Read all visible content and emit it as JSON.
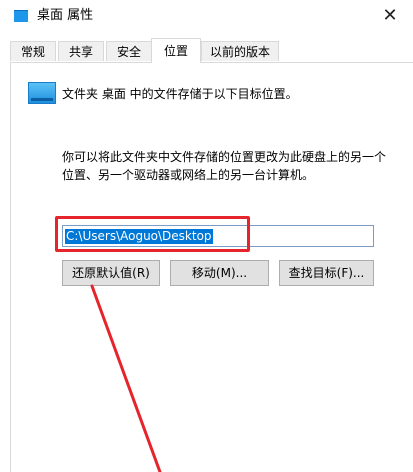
{
  "window": {
    "title": "桌面 属性",
    "close_glyph": "✕"
  },
  "tabs": [
    {
      "label": "常规",
      "active": false
    },
    {
      "label": "共享",
      "active": false
    },
    {
      "label": "安全",
      "active": false
    },
    {
      "label": "位置",
      "active": true
    },
    {
      "label": "以前的版本",
      "active": false
    }
  ],
  "location": {
    "heading": "文件夹 桌面 中的文件存储于以下目标位置。",
    "description_lines": [
      "你可以将此文件夹中文件存储的位置更改为此硬盘上的另一个",
      "位置、另一个驱动器或网络上的另一台计算机。"
    ],
    "path_value": "C:\\Users\\Aoguo\\Desktop"
  },
  "buttons": {
    "restore_default": "还原默认值(R)",
    "move": "移动(M)...",
    "find_target": "查找目标(F)..."
  },
  "colors": {
    "highlight": "#e5242b",
    "selection": "#0078d7",
    "folder": "#1c97ea"
  }
}
